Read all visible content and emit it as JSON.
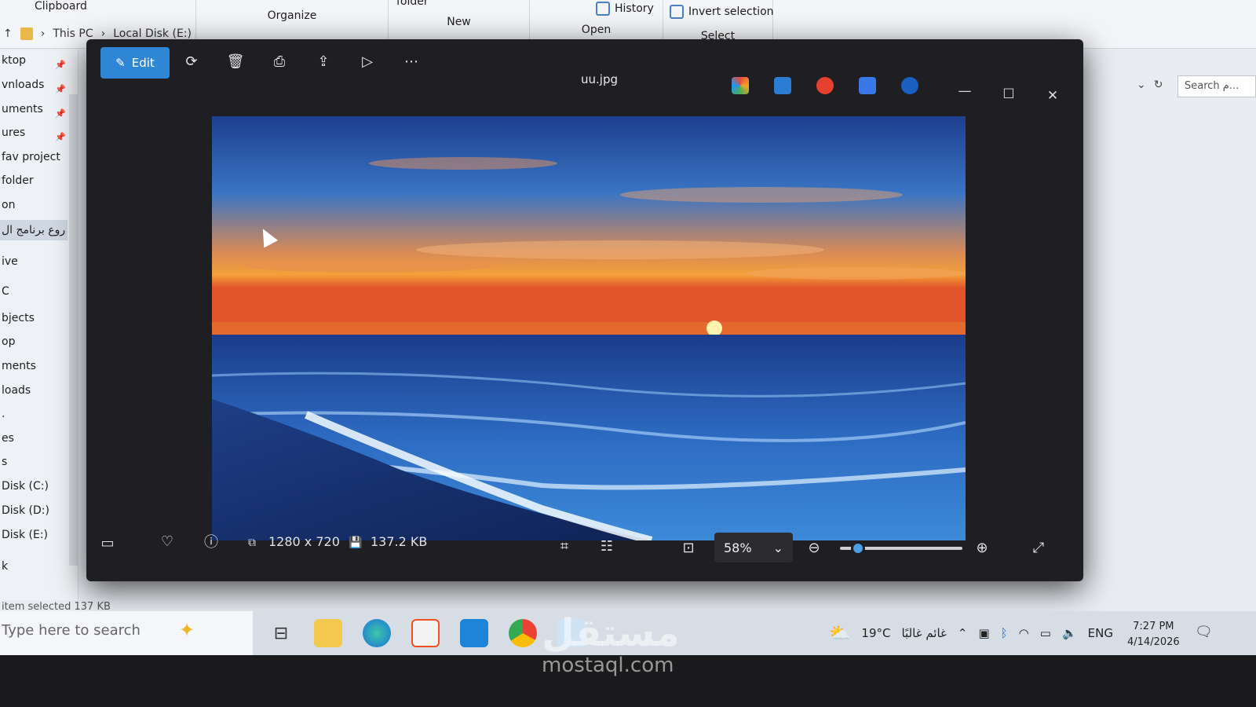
{
  "explorer": {
    "ribbon_groups": [
      "Clipboard",
      "Organize",
      "New",
      "Open",
      "Select"
    ],
    "ribbon_items": {
      "folder": "folder",
      "history": "History",
      "invert_selection": "Invert selection"
    },
    "address": [
      "This PC",
      "Local Disk (E:)"
    ],
    "search_placeholder": "Search م...",
    "nav_items": [
      "ktop",
      "vnloads",
      "uments",
      "ures",
      "fav project",
      "folder",
      "on",
      "روع برنامج ال",
      "ive",
      "C",
      "bjects",
      "op",
      "ments",
      "loads",
      ".",
      "es",
      "s",
      "Disk (C:)",
      "Disk (D:)",
      "Disk (E:)",
      "k"
    ],
    "status": "item selected  137 KB"
  },
  "photos": {
    "edit_label": "Edit",
    "file_name": "uu.jpg",
    "dimensions": "1280 x 720",
    "file_size": "137.2 KB",
    "zoom": "58%",
    "zoom_level": 0.15
  },
  "taskbar": {
    "search_placeholder": "Type here to search",
    "weather_temp": "19°C",
    "weather_desc": "غائم غالبًا",
    "language": "ENG",
    "time": "7:27 PM",
    "date": "4/14/2026"
  },
  "watermark": {
    "arabic": "مستقل",
    "latin": "mostaql.com"
  }
}
